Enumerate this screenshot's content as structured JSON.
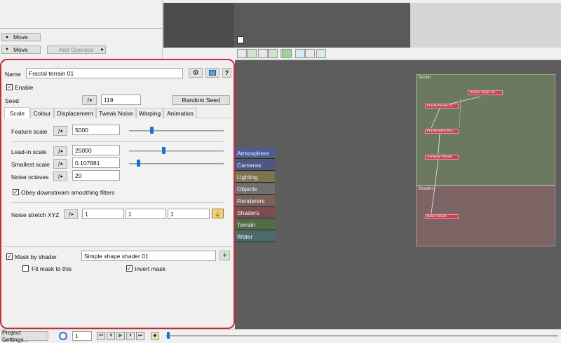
{
  "colors": {
    "accent": "#1a72c9",
    "panel_highlight": "#c92a3c",
    "node_red": "#c8414f",
    "terrain_group": "#6b7a5e",
    "shaders_group": "#7d6464",
    "canvas": "#5d5d5d"
  },
  "left_top": {
    "move_up": "Move",
    "move_down": "Move",
    "add_operator": "Add Operator"
  },
  "panel": {
    "name_label": "Name",
    "name_value": "Fractal terrain 01",
    "help_label": "?",
    "enable_label": "Enable",
    "seed_label": "Seed",
    "seed_value": "119",
    "random_seed": "Random Seed",
    "tabs": [
      "Scale",
      "Colour",
      "Displacement",
      "Tweak Noise",
      "Warping",
      "Animation"
    ],
    "feature_scale_label": "Feature scale",
    "feature_scale_value": "5000",
    "feature_scale_slider": 0.18,
    "lead_in_label": "Lead-in scale",
    "lead_in_value": "25000",
    "lead_in_slider": 0.37,
    "smallest_label": "Smallest scale",
    "smallest_value": "0.107881",
    "smallest_slider": 0.1,
    "octaves_label": "Noise octaves",
    "octaves_value": "20",
    "obey_label": "Obey downstream smoothing filters",
    "stretch_label": "Noise stretch XYZ",
    "stretch_x": "1",
    "stretch_y": "1",
    "stretch_z": "1",
    "mask_label": "Mask by shader",
    "mask_value": "Simple shape shader 01",
    "fit_mask_label": "Fit mask to this",
    "invert_mask_label": "Invert mask"
  },
  "categories": [
    "Atmosphere",
    "Cameras",
    "Lighting",
    "Objects",
    "Renderers",
    "Shaders",
    "Terrain",
    "Water"
  ],
  "groups": {
    "terrain": "Terrain",
    "shaders": "Shaders"
  },
  "nodes": {
    "n1": "Fractal terrain 01",
    "n2": "Simple shape sh...",
    "n3": "Fractal warp sha...",
    "n4": "Compute Terrain",
    "n5": "Base colours"
  },
  "bottom": {
    "project_settings": "Project Settings...",
    "frame": "1"
  }
}
